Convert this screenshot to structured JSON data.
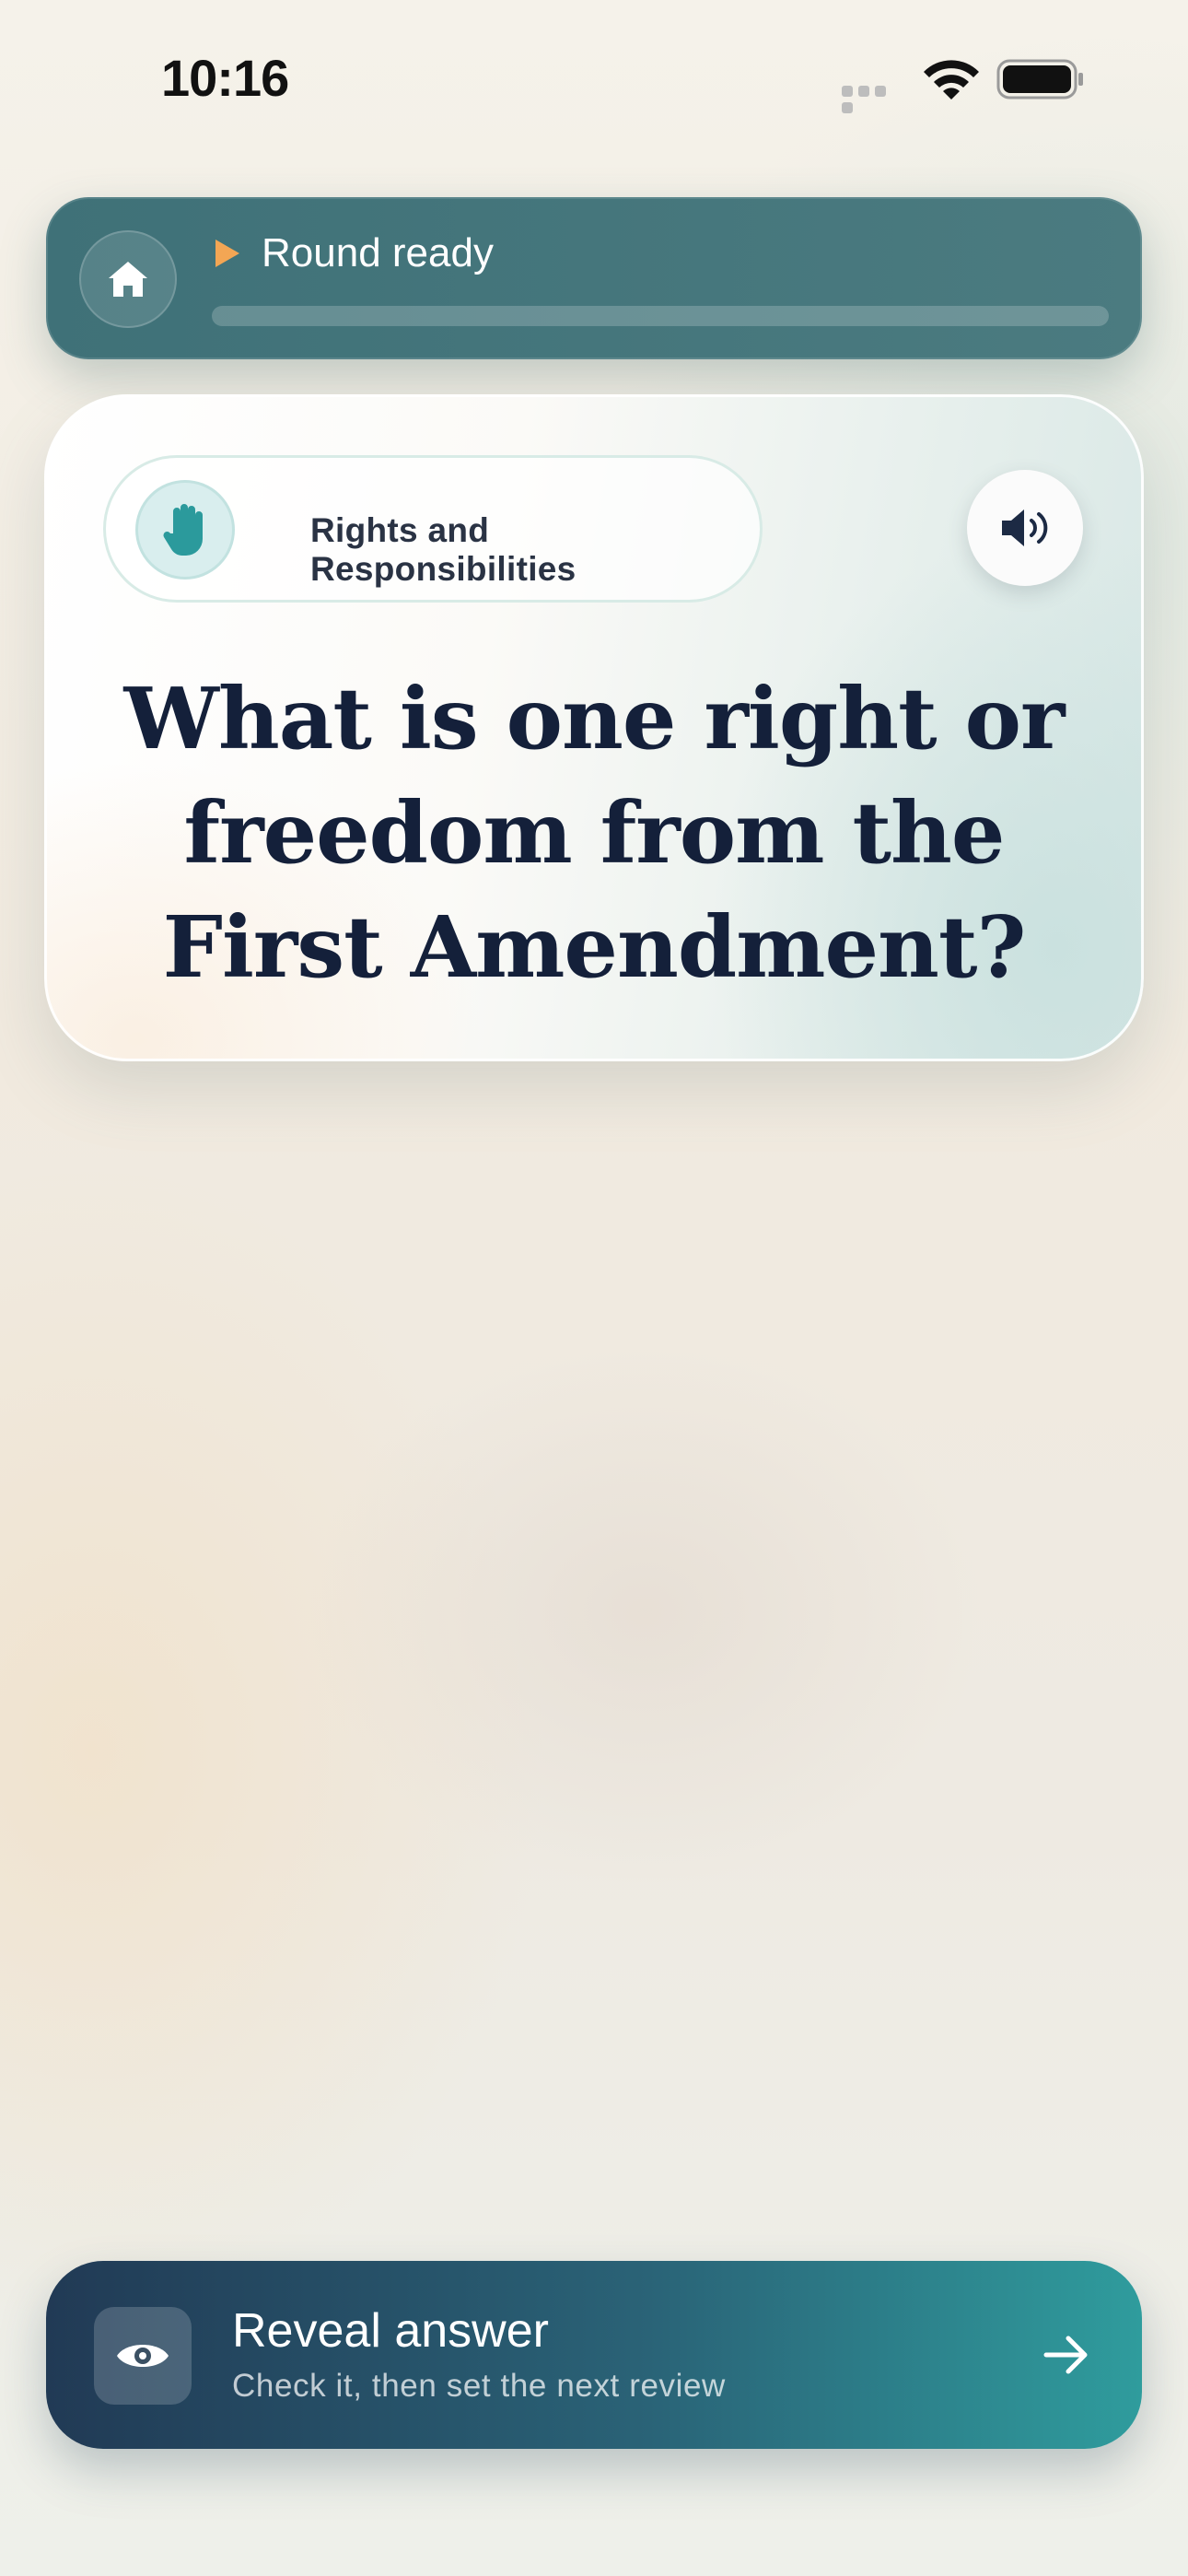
{
  "status_bar": {
    "time": "10:16"
  },
  "round": {
    "title": "Round ready",
    "progress": 0
  },
  "question_card": {
    "category": "Rights and Responsibilities",
    "category_icon": "raised-hand-icon",
    "question": "What is one right or freedom from the First Amendment?"
  },
  "reveal": {
    "title": "Reveal answer",
    "subtitle": "Check it, then set the next review"
  },
  "colors": {
    "accent_teal": "#2f9c9d",
    "top_card": "#447479",
    "play_orange": "#f3a654",
    "question_text": "#14203a"
  }
}
